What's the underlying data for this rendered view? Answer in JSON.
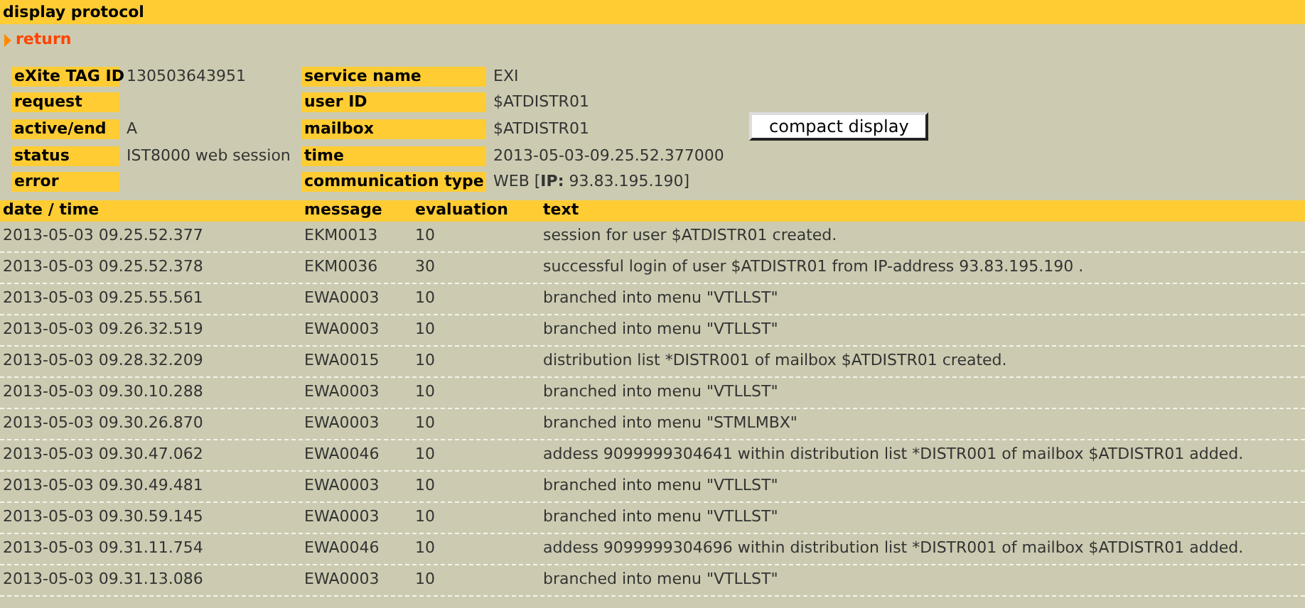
{
  "title": "display protocol",
  "return_link": "return",
  "details": [
    {
      "label": "eXite TAG ID",
      "value": "130503643951",
      "label_2": "service name",
      "value_2": "EXI"
    },
    {
      "label": "request",
      "label_2": "user ID",
      "value_2": "$ATDISTR01"
    },
    {
      "label": "active/end",
      "value": "A",
      "label_2": "mailbox",
      "value_2": "$ATDISTR01"
    },
    {
      "label": "status",
      "value": "IST8000 web session",
      "label_2": "time",
      "value_2": "2013-05-03-09.25.52.377000"
    },
    {
      "label": "error",
      "label_2": "communication type",
      "value_2": "WEB  [**IP:** 93.83.195.190]"
    }
  ],
  "compact_button": "compact display",
  "table": {
    "columns": [
      "date / time",
      "message",
      "evaluation",
      "text"
    ],
    "rows": [
      [
        "2013-05-03 09.25.52.377",
        "EKM0013",
        "10",
        "session for user $ATDISTR01 created."
      ],
      [
        "2013-05-03 09.25.52.378",
        "EKM0036",
        "30",
        "successful login of user $ATDISTR01 from IP-address 93.83.195.190 ."
      ],
      [
        "2013-05-03 09.25.55.561",
        "EWA0003",
        "10",
        "branched into menu \"VTLLST\""
      ],
      [
        "2013-05-03 09.26.32.519",
        "EWA0003",
        "10",
        "branched into menu \"VTLLST\""
      ],
      [
        "2013-05-03 09.28.32.209",
        "EWA0015",
        "10",
        "distribution list *DISTR001 of mailbox $ATDISTR01 created."
      ],
      [
        "2013-05-03 09.30.10.288",
        "EWA0003",
        "10",
        "branched into menu \"VTLLST\""
      ],
      [
        "2013-05-03 09.30.26.870",
        "EWA0003",
        "10",
        "branched into menu \"STMLMBX\""
      ],
      [
        "2013-05-03 09.30.47.062",
        "EWA0046",
        "10",
        "addess 9099999304641 within distribution list *DISTR001 of mailbox $ATDISTR01 added."
      ],
      [
        "2013-05-03 09.30.49.481",
        "EWA0003",
        "10",
        "branched into menu \"VTLLST\""
      ],
      [
        "2013-05-03 09.30.59.145",
        "EWA0003",
        "10",
        "branched into menu \"VTLLST\""
      ],
      [
        "2013-05-03 09.31.11.754",
        "EWA0046",
        "10",
        "addess 9099999304696 within distribution list *DISTR001 of mailbox $ATDISTR01 added."
      ],
      [
        "2013-05-03 09.31.13.086",
        "EWA0003",
        "10",
        "branched into menu \"VTLLST\""
      ]
    ]
  }
}
